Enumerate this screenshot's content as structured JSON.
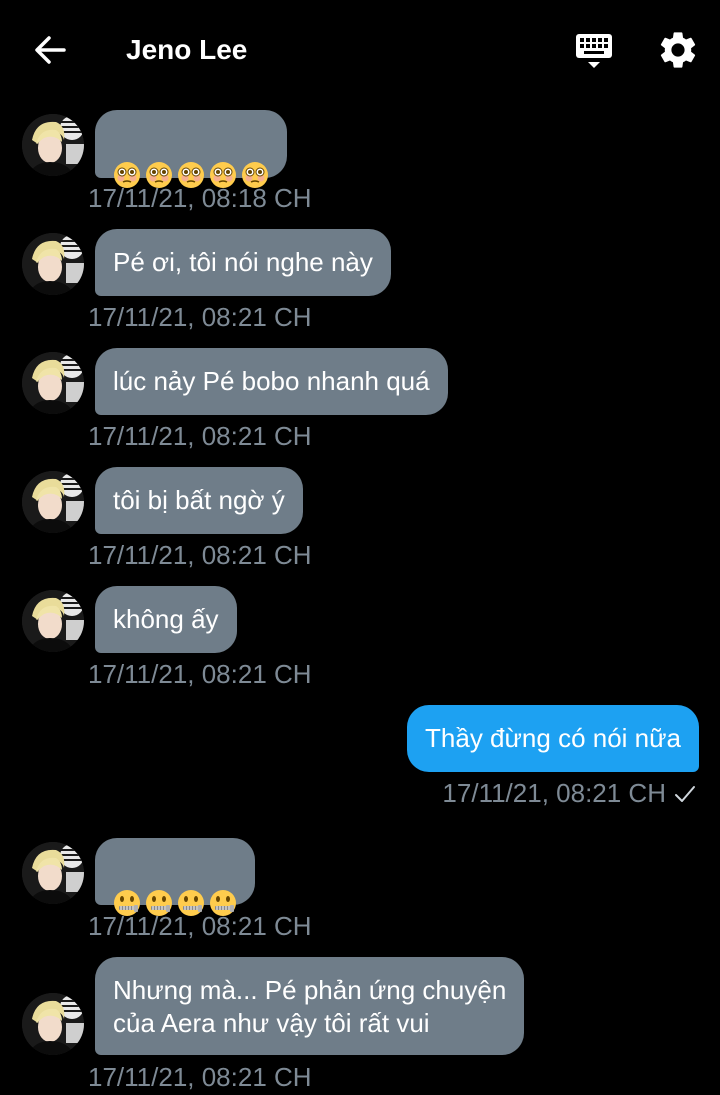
{
  "header": {
    "title": "Jeno Lee",
    "back_icon": "arrow-left-icon",
    "keyboard_icon": "keyboard-icon",
    "settings_icon": "gear-icon"
  },
  "colors": {
    "background": "#000000",
    "incoming_bubble": "#6f7d89",
    "outgoing_bubble": "#1da1f2",
    "timestamp": "#7e8a95"
  },
  "messages": [
    {
      "direction": "in",
      "content": "flushed-emoji x5",
      "emoji": "flushed-face",
      "emoji_count": 5,
      "time": "17/11/21, 08:18 CH"
    },
    {
      "direction": "in",
      "text": "Pé ơi, tôi nói nghe này",
      "time": "17/11/21, 08:21 CH"
    },
    {
      "direction": "in",
      "text": "lúc nảy Pé bobo nhanh quá",
      "time": "17/11/21, 08:21 CH"
    },
    {
      "direction": "in",
      "text": "tôi bị bất ngờ ý",
      "time": "17/11/21, 08:21 CH"
    },
    {
      "direction": "in",
      "text": "không ấy",
      "time": "17/11/21, 08:21 CH"
    },
    {
      "direction": "out",
      "text": "Thầy đừng có nói nữa",
      "time": "17/11/21, 08:21 CH",
      "status_icon": "check-icon"
    },
    {
      "direction": "in",
      "content": "zipper-mouth-emoji x4",
      "emoji": "zipper-mouth-face",
      "emoji_count": 4,
      "time": "17/11/21, 08:21 CH"
    },
    {
      "direction": "in",
      "text": "Nhưng mà... Pé phản ứng chuyện\ncủa Aera như vậy tôi rất vui",
      "time": "17/11/21, 08:21 CH"
    }
  ]
}
